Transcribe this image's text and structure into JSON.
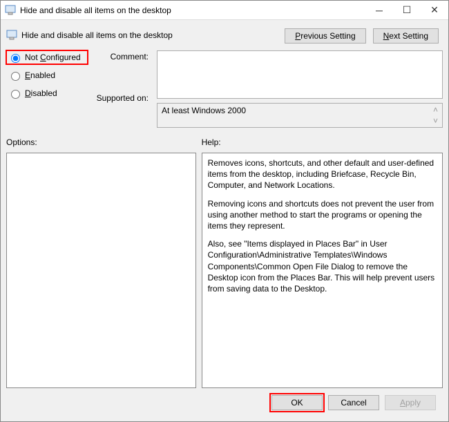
{
  "titlebar": {
    "title": "Hide and disable all items on the desktop"
  },
  "subheader": {
    "subtitle": "Hide and disable all items on the desktop"
  },
  "topbuttons": {
    "previous": "Previous Setting",
    "next": "Next Setting"
  },
  "radios": {
    "not_configured": "Not Configured",
    "enabled": "Enabled",
    "disabled": "Disabled"
  },
  "labels": {
    "comment": "Comment:",
    "supported": "Supported on:",
    "options": "Options:",
    "help": "Help:"
  },
  "fields": {
    "comment_value": "",
    "supported_value": "At least Windows 2000"
  },
  "help": {
    "p1": "Removes icons, shortcuts, and other default and user-defined items from the desktop, including Briefcase, Recycle Bin, Computer, and Network Locations.",
    "p2": "Removing icons and shortcuts does not prevent the user from using another method to start the programs or opening the items they represent.",
    "p3": "Also, see \"Items displayed in Places Bar\" in User Configuration\\Administrative Templates\\Windows Components\\Common Open File Dialog to remove the Desktop icon from the Places Bar. This will help prevent users from saving data to the Desktop."
  },
  "footer": {
    "ok": "OK",
    "cancel": "Cancel",
    "apply": "Apply"
  }
}
